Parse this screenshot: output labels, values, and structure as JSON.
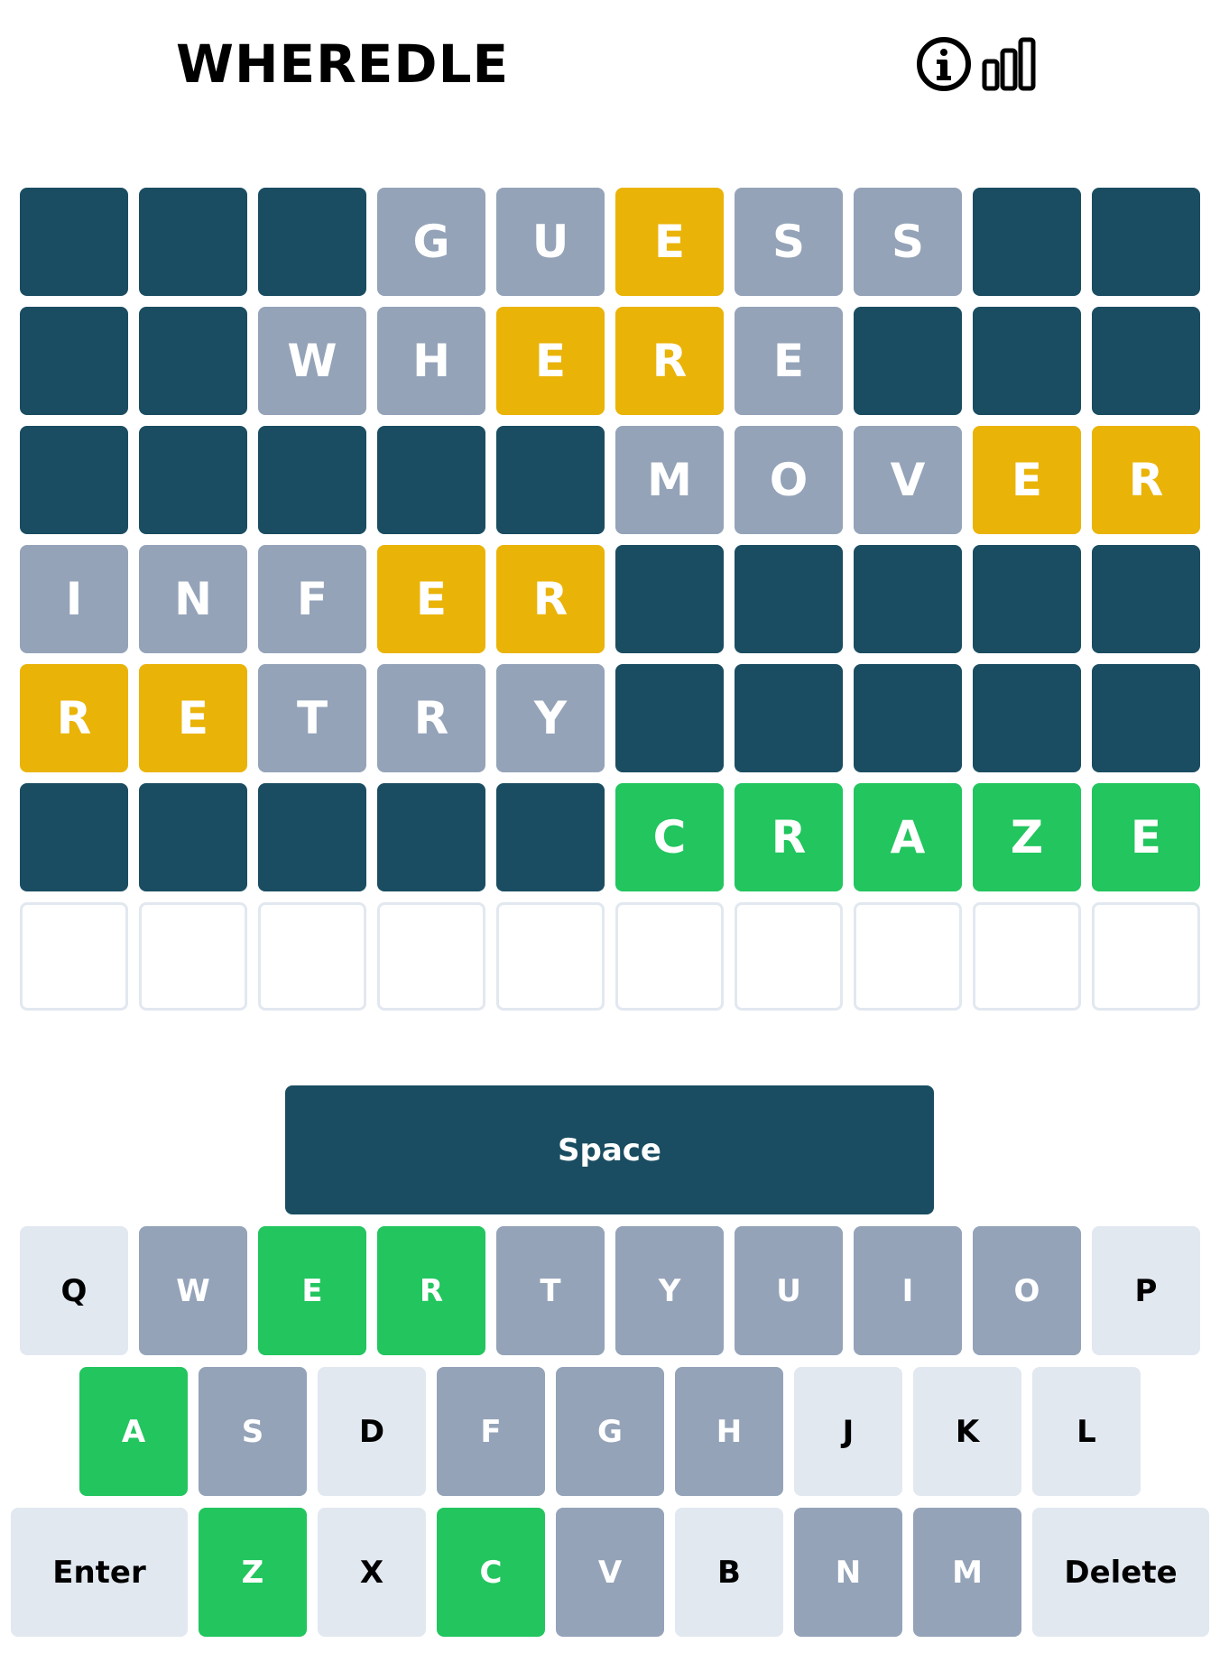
{
  "header": {
    "title": "WHEREDLE",
    "icons": [
      "info-icon",
      "stats-icon"
    ]
  },
  "colors": {
    "black": "#1a4d61",
    "absent": "#94a3b8",
    "present": "#eab308",
    "correct": "#22c55e",
    "unused": "#e2e8f0",
    "empty_border": "#e2e8f0"
  },
  "board": {
    "rows": [
      [
        {
          "letter": "",
          "state": "black"
        },
        {
          "letter": "",
          "state": "black"
        },
        {
          "letter": "",
          "state": "black"
        },
        {
          "letter": "G",
          "state": "absent"
        },
        {
          "letter": "U",
          "state": "absent"
        },
        {
          "letter": "E",
          "state": "present"
        },
        {
          "letter": "S",
          "state": "absent"
        },
        {
          "letter": "S",
          "state": "absent"
        },
        {
          "letter": "",
          "state": "black"
        },
        {
          "letter": "",
          "state": "black"
        }
      ],
      [
        {
          "letter": "",
          "state": "black"
        },
        {
          "letter": "",
          "state": "black"
        },
        {
          "letter": "W",
          "state": "absent"
        },
        {
          "letter": "H",
          "state": "absent"
        },
        {
          "letter": "E",
          "state": "present"
        },
        {
          "letter": "R",
          "state": "present"
        },
        {
          "letter": "E",
          "state": "absent"
        },
        {
          "letter": "",
          "state": "black"
        },
        {
          "letter": "",
          "state": "black"
        },
        {
          "letter": "",
          "state": "black"
        }
      ],
      [
        {
          "letter": "",
          "state": "black"
        },
        {
          "letter": "",
          "state": "black"
        },
        {
          "letter": "",
          "state": "black"
        },
        {
          "letter": "",
          "state": "black"
        },
        {
          "letter": "",
          "state": "black"
        },
        {
          "letter": "M",
          "state": "absent"
        },
        {
          "letter": "O",
          "state": "absent"
        },
        {
          "letter": "V",
          "state": "absent"
        },
        {
          "letter": "E",
          "state": "present"
        },
        {
          "letter": "R",
          "state": "present"
        }
      ],
      [
        {
          "letter": "I",
          "state": "absent"
        },
        {
          "letter": "N",
          "state": "absent"
        },
        {
          "letter": "F",
          "state": "absent"
        },
        {
          "letter": "E",
          "state": "present"
        },
        {
          "letter": "R",
          "state": "present"
        },
        {
          "letter": "",
          "state": "black"
        },
        {
          "letter": "",
          "state": "black"
        },
        {
          "letter": "",
          "state": "black"
        },
        {
          "letter": "",
          "state": "black"
        },
        {
          "letter": "",
          "state": "black"
        }
      ],
      [
        {
          "letter": "R",
          "state": "present"
        },
        {
          "letter": "E",
          "state": "present"
        },
        {
          "letter": "T",
          "state": "absent"
        },
        {
          "letter": "R",
          "state": "absent"
        },
        {
          "letter": "Y",
          "state": "absent"
        },
        {
          "letter": "",
          "state": "black"
        },
        {
          "letter": "",
          "state": "black"
        },
        {
          "letter": "",
          "state": "black"
        },
        {
          "letter": "",
          "state": "black"
        },
        {
          "letter": "",
          "state": "black"
        }
      ],
      [
        {
          "letter": "",
          "state": "black"
        },
        {
          "letter": "",
          "state": "black"
        },
        {
          "letter": "",
          "state": "black"
        },
        {
          "letter": "",
          "state": "black"
        },
        {
          "letter": "",
          "state": "black"
        },
        {
          "letter": "C",
          "state": "correct"
        },
        {
          "letter": "R",
          "state": "correct"
        },
        {
          "letter": "A",
          "state": "correct"
        },
        {
          "letter": "Z",
          "state": "correct"
        },
        {
          "letter": "E",
          "state": "correct"
        }
      ],
      [
        {
          "letter": "",
          "state": "empty"
        },
        {
          "letter": "",
          "state": "empty"
        },
        {
          "letter": "",
          "state": "empty"
        },
        {
          "letter": "",
          "state": "empty"
        },
        {
          "letter": "",
          "state": "empty"
        },
        {
          "letter": "",
          "state": "empty"
        },
        {
          "letter": "",
          "state": "empty"
        },
        {
          "letter": "",
          "state": "empty"
        },
        {
          "letter": "",
          "state": "empty"
        },
        {
          "letter": "",
          "state": "empty"
        }
      ]
    ]
  },
  "keyboard": {
    "space_label": "Space",
    "rows": [
      [
        {
          "label": "Q",
          "state": "unused"
        },
        {
          "label": "W",
          "state": "absent"
        },
        {
          "label": "E",
          "state": "correct"
        },
        {
          "label": "R",
          "state": "correct"
        },
        {
          "label": "T",
          "state": "absent"
        },
        {
          "label": "Y",
          "state": "absent"
        },
        {
          "label": "U",
          "state": "absent"
        },
        {
          "label": "I",
          "state": "absent"
        },
        {
          "label": "O",
          "state": "absent"
        },
        {
          "label": "P",
          "state": "unused"
        }
      ],
      [
        {
          "label": "A",
          "state": "correct"
        },
        {
          "label": "S",
          "state": "absent"
        },
        {
          "label": "D",
          "state": "unused"
        },
        {
          "label": "F",
          "state": "absent"
        },
        {
          "label": "G",
          "state": "absent"
        },
        {
          "label": "H",
          "state": "absent"
        },
        {
          "label": "J",
          "state": "unused"
        },
        {
          "label": "K",
          "state": "unused"
        },
        {
          "label": "L",
          "state": "unused"
        }
      ],
      [
        {
          "label": "Enter",
          "state": "unused",
          "wide": true
        },
        {
          "label": "Z",
          "state": "correct"
        },
        {
          "label": "X",
          "state": "unused"
        },
        {
          "label": "C",
          "state": "correct"
        },
        {
          "label": "V",
          "state": "absent"
        },
        {
          "label": "B",
          "state": "unused"
        },
        {
          "label": "N",
          "state": "absent"
        },
        {
          "label": "M",
          "state": "absent"
        },
        {
          "label": "Delete",
          "state": "unused",
          "wide": true
        }
      ]
    ]
  }
}
